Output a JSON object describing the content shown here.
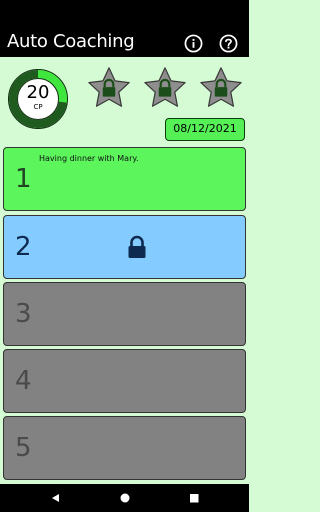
{
  "app": {
    "title": "Auto Coaching",
    "info_icon": "info-icon",
    "help_icon": "help-icon"
  },
  "cp": {
    "value": "20",
    "unit": "CP",
    "progress": 0.27,
    "ring_color": "#3ee63e",
    "ring_track_color": "#1f5a1f"
  },
  "stars": [
    {
      "icon": "locked-star-icon",
      "locked": true
    },
    {
      "icon": "locked-star-icon",
      "locked": true
    },
    {
      "icon": "locked-star-icon",
      "locked": true
    }
  ],
  "date": "08/12/2021",
  "slots": [
    {
      "number": "1",
      "note": "Having dinner with Mary.",
      "state": "active",
      "color": "#5cf55c"
    },
    {
      "number": "2",
      "note": "",
      "state": "locked",
      "color": "#84ccff"
    },
    {
      "number": "3",
      "note": "",
      "state": "disabled",
      "color": "#828282"
    },
    {
      "number": "4",
      "note": "",
      "state": "disabled",
      "color": "#828282"
    },
    {
      "number": "5",
      "note": "",
      "state": "disabled",
      "color": "#828282"
    }
  ],
  "nav": {
    "back_icon": "back-triangle-icon",
    "home_icon": "home-circle-icon",
    "recents_icon": "recents-square-icon"
  }
}
